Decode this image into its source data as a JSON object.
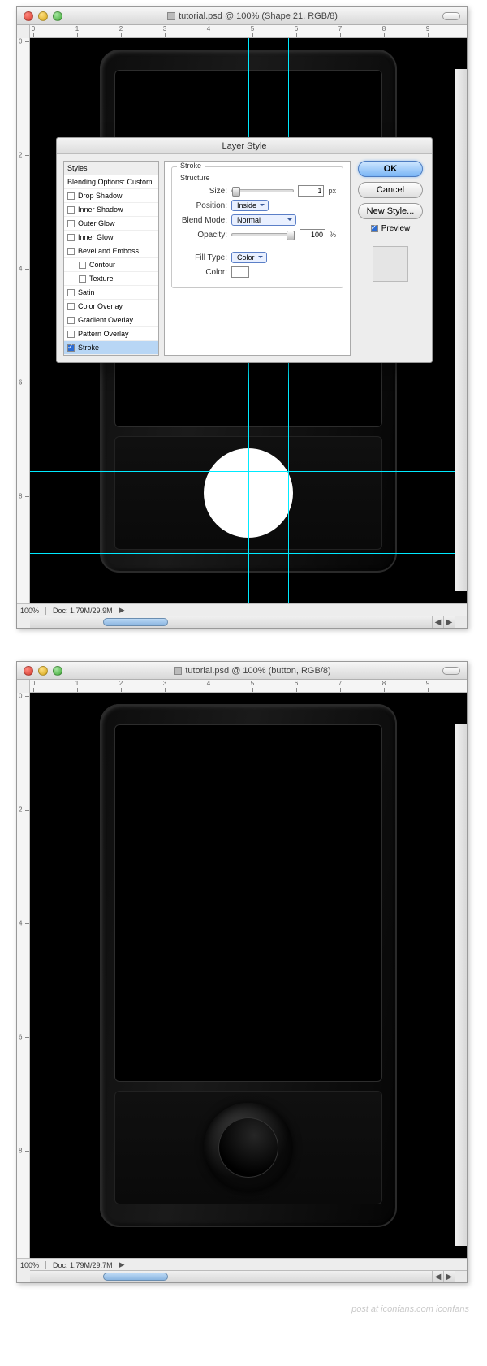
{
  "window1": {
    "title": "tutorial.psd @ 100% (Shape 21, RGB/8)",
    "zoom": "100%",
    "docinfo": "Doc: 1.79M/29.9M",
    "ruler_numbers": [
      "0",
      "1",
      "2",
      "3",
      "4",
      "5",
      "6",
      "7",
      "8",
      "9"
    ],
    "ruler_v": [
      "0",
      "2",
      "4",
      "6",
      "8"
    ]
  },
  "window2": {
    "title": "tutorial.psd @ 100% (button, RGB/8)",
    "zoom": "100%",
    "docinfo": "Doc: 1.79M/29.7M",
    "ruler_numbers": [
      "0",
      "1",
      "2",
      "3",
      "4",
      "5",
      "6",
      "7",
      "8",
      "9"
    ],
    "ruler_v": [
      "0",
      "2",
      "4",
      "6",
      "8"
    ]
  },
  "dialog": {
    "title": "Layer Style",
    "sidebar_header": "Styles",
    "sidebar_sub": "Blending Options: Custom",
    "styles": [
      {
        "label": "Drop Shadow",
        "on": false
      },
      {
        "label": "Inner Shadow",
        "on": false
      },
      {
        "label": "Outer Glow",
        "on": false
      },
      {
        "label": "Inner Glow",
        "on": false
      },
      {
        "label": "Bevel and Emboss",
        "on": false
      },
      {
        "label": "Contour",
        "on": false,
        "sub": true
      },
      {
        "label": "Texture",
        "on": false,
        "sub": true
      },
      {
        "label": "Satin",
        "on": false
      },
      {
        "label": "Color Overlay",
        "on": false
      },
      {
        "label": "Gradient Overlay",
        "on": false
      },
      {
        "label": "Pattern Overlay",
        "on": false
      },
      {
        "label": "Stroke",
        "on": true,
        "selected": true
      }
    ],
    "group1": "Stroke",
    "group2": "Structure",
    "size_label": "Size:",
    "size_val": "1",
    "size_unit": "px",
    "position_label": "Position:",
    "position_val": "Inside",
    "blend_label": "Blend Mode:",
    "blend_val": "Normal",
    "opacity_label": "Opacity:",
    "opacity_val": "100",
    "opacity_unit": "%",
    "fill_label": "Fill Type:",
    "fill_val": "Color",
    "color_label": "Color:",
    "ok": "OK",
    "cancel": "Cancel",
    "new_style": "New Style...",
    "preview": "Preview"
  },
  "watermark": "post at iconfans.com iconfans"
}
